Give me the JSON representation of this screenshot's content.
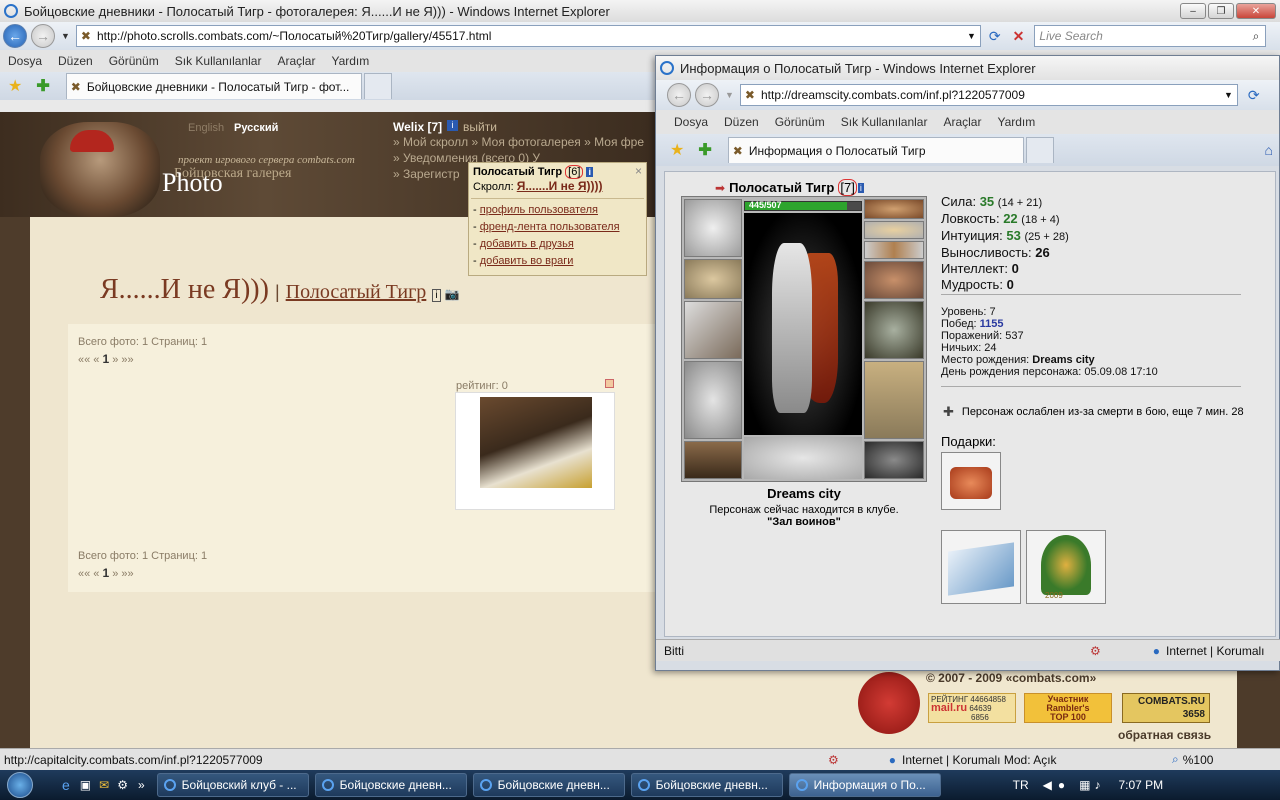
{
  "main_window": {
    "title": "Бойцовские дневники - Полосатый Тигр - фотогалерея: Я......И не Я))) - Windows Internet Explorer",
    "url": "http://photo.scrolls.combats.com/~Полосатый%20Тигр/gallery/45517.html",
    "search_placeholder": "Live Search",
    "menu": [
      "Dosya",
      "Düzen",
      "Görünüm",
      "Sık Kullanılanlar",
      "Araçlar",
      "Yardım"
    ],
    "tab_label": "Бойцовские дневники - Полосатый Тигр - фот...",
    "status_url": "http://capitalcity.combats.com/inf.pl?1220577009",
    "status_zone": "Internet | Korumalı Mod: Açık",
    "zoom": "%100"
  },
  "page": {
    "lang_en": "English",
    "lang_ru": "Русский",
    "user": "Welix [7]",
    "logout": "выйти",
    "nav_row1": "» Мой скролл » Моя фотогалерея » Моя фре",
    "nav_row2": "» Уведомления (всего 0) У",
    "nav_row3": "» Зарегистр",
    "project_text": "проект игрового сервера combats.com",
    "gallery_text": "Бойцовская галерея",
    "photo_text": "Photo",
    "gallery_title": "Я......И не Я)))",
    "separator": "|",
    "gallery_owner": "Полосатый Тигр",
    "total_line": "Всего фото: 1 Страниц: 1",
    "pager_prev": "«« «",
    "pager_current": "1",
    "pager_next": "» »»",
    "rating_label": "рейтинг: 0",
    "footer_copyright": "© 2007 - 2009 «combats.com»",
    "feedback": "обратная связь",
    "counter1_top": "РЕЙТИНГ",
    "counter1_a": "44664858",
    "counter1_b": "64639",
    "counter1_c": "6856",
    "counter1_brand": "mail.ru",
    "counter2_a": "Участник",
    "counter2_b": "Rambler's",
    "counter2_c": "TOP 100",
    "counter3_brand": "COMBATS.RU",
    "counter3_num": "3658"
  },
  "popup": {
    "name": "Полосатый Тигр",
    "level": "6",
    "scroll_label": "Скролл:",
    "scroll_link": "Я.......И не Я))))",
    "close": "×",
    "links": [
      "профиль пользователя",
      "френд-лента пользователя",
      "добавить в друзья",
      "добавить во враги"
    ]
  },
  "info_window": {
    "title": "Информация о Полосатый Тигр - Windows Internet Explorer",
    "url": "http://dreamscity.combats.com/inf.pl?1220577009",
    "menu": [
      "Dosya",
      "Düzen",
      "Görünüm",
      "Sık Kullanılanlar",
      "Araçlar",
      "Yardım"
    ],
    "tab_label": "Информация о Полосатый Тигр",
    "status_left": "Bitti",
    "status_zone": "Internet | Korumalı",
    "char_name": "Полосатый Тигр",
    "char_level": "[7]",
    "hp": "445/507",
    "hp_fraction": 0.88,
    "city": "Dreams city",
    "location_line": "Персонаж сейчас находится в клубе.",
    "location_room": "\"Зал воинов\"",
    "stats": [
      {
        "label": "Сила:",
        "value": "35",
        "detail": "(14 + 21)"
      },
      {
        "label": "Ловкость:",
        "value": "22",
        "detail": "(18 + 4)"
      },
      {
        "label": "Интуиция:",
        "value": "53",
        "detail": "(25 + 28)"
      },
      {
        "label": "Выносливость:",
        "value": "26",
        "detail": ""
      },
      {
        "label": "Интеллект:",
        "value": "0",
        "detail": ""
      },
      {
        "label": "Мудрость:",
        "value": "0",
        "detail": ""
      }
    ],
    "level_line": "Уровень: 7",
    "wins_label": "Побед:",
    "wins": "1155",
    "losses_line": "Поражений: 537",
    "draws_line": "Ничьих: 24",
    "birthplace_label": "Место рождения:",
    "birthplace": "Dreams city",
    "birthday_line": "День рождения персонажа: 05.09.08 17:10",
    "weakened": "Персонаж ослаблен из-за смерти в бою, еще 7 мин. 28",
    "gifts_label": "Подарки:",
    "gift_year": "2009"
  },
  "taskbar": {
    "items": [
      "Бойцовский клуб - ...",
      "Бойцовские дневн...",
      "Бойцовские дневн...",
      "Бойцовские дневн...",
      "Информация о По..."
    ],
    "lang": "TR",
    "time": "7:07 PM"
  }
}
